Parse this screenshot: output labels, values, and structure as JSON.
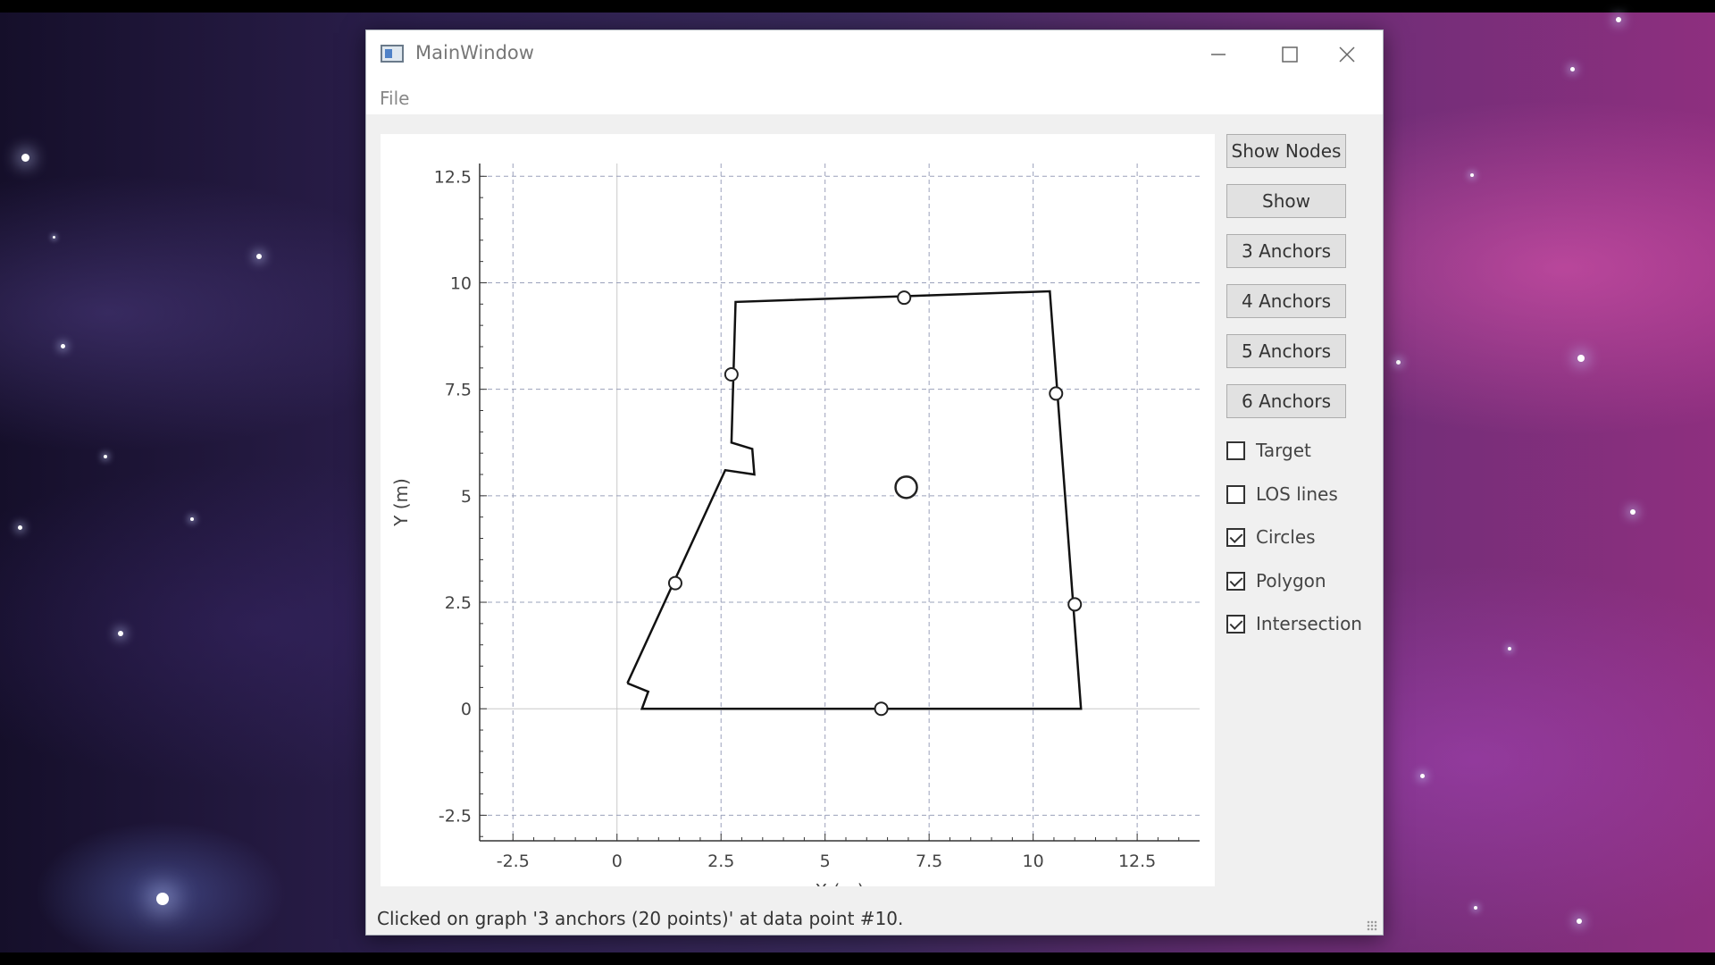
{
  "window": {
    "title": "MainWindow",
    "menu": [
      "File"
    ]
  },
  "sidebar": {
    "buttons": [
      "Show Nodes",
      "Show",
      "3 Anchors",
      "4 Anchors",
      "5 Anchors",
      "6 Anchors"
    ],
    "checkboxes": [
      {
        "label": "Target",
        "checked": false
      },
      {
        "label": "LOS lines",
        "checked": false
      },
      {
        "label": "Circles",
        "checked": true
      },
      {
        "label": "Polygon",
        "checked": true
      },
      {
        "label": "Intersection",
        "checked": true
      }
    ]
  },
  "status": {
    "message": "Clicked on graph '3 anchors (20 points)' at data point #10."
  },
  "chart_data": {
    "type": "line",
    "xlabel": "X (m)",
    "ylabel": "Y (m)",
    "xlim": [
      -3.3,
      14.0
    ],
    "ylim": [
      -3.1,
      12.8
    ],
    "xticks": [
      "-2.5",
      "0",
      "2.5",
      "5",
      "7.5",
      "10",
      "12.5"
    ],
    "yticks": [
      "-2.5",
      "0",
      "2.5",
      "5",
      "7.5",
      "10",
      "12.5"
    ],
    "xtick_values": [
      -2.5,
      0,
      2.5,
      5,
      7.5,
      10,
      12.5
    ],
    "ytick_values": [
      -2.5,
      0,
      2.5,
      5,
      7.5,
      10,
      12.5
    ],
    "grid": true,
    "series": [
      {
        "values": [
          [
            0.25,
            0.6
          ],
          [
            0.75,
            0.4
          ],
          [
            0.6,
            0.0
          ],
          [
            11.15,
            0.0
          ],
          [
            10.4,
            9.8
          ],
          [
            2.85,
            9.55
          ],
          [
            2.75,
            6.25
          ],
          [
            3.25,
            6.1
          ],
          [
            3.3,
            5.5
          ],
          [
            2.6,
            5.6
          ],
          [
            0.25,
            0.6
          ]
        ]
      }
    ],
    "markers": [
      [
        6.35,
        0.0
      ],
      [
        11.0,
        2.45
      ],
      [
        10.55,
        7.4
      ],
      [
        6.9,
        9.65
      ],
      [
        2.75,
        7.85
      ],
      [
        1.4,
        2.95
      ]
    ],
    "target": [
      6.95,
      5.2
    ]
  }
}
